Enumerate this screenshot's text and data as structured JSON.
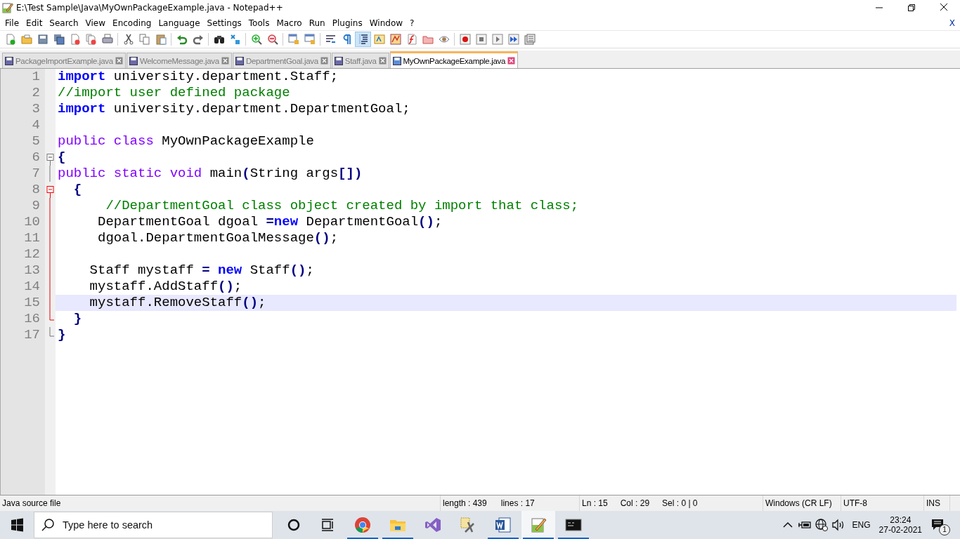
{
  "window": {
    "title": "E:\\Test Sample\\Java\\MyOwnPackageExample.java - Notepad++"
  },
  "menu": {
    "items": [
      "File",
      "Edit",
      "Search",
      "View",
      "Encoding",
      "Language",
      "Settings",
      "Tools",
      "Macro",
      "Run",
      "Plugins",
      "Window",
      "?"
    ],
    "close_label": "X"
  },
  "toolbar": [
    {
      "kind": "new",
      "pressed": false
    },
    {
      "kind": "open",
      "pressed": false
    },
    {
      "kind": "save",
      "pressed": false
    },
    {
      "kind": "save-all",
      "pressed": false
    },
    {
      "kind": "close",
      "pressed": false
    },
    {
      "kind": "close-all",
      "pressed": false
    },
    {
      "kind": "print",
      "pressed": false
    },
    {
      "kind": "separator"
    },
    {
      "kind": "cut",
      "pressed": false
    },
    {
      "kind": "copy",
      "pressed": false
    },
    {
      "kind": "paste",
      "pressed": false
    },
    {
      "kind": "separator"
    },
    {
      "kind": "undo",
      "pressed": false
    },
    {
      "kind": "redo",
      "pressed": false
    },
    {
      "kind": "separator"
    },
    {
      "kind": "find",
      "pressed": false
    },
    {
      "kind": "replace",
      "pressed": false
    },
    {
      "kind": "separator"
    },
    {
      "kind": "zoom-in",
      "pressed": false
    },
    {
      "kind": "zoom-out",
      "pressed": false
    },
    {
      "kind": "separator"
    },
    {
      "kind": "sync-v",
      "pressed": false
    },
    {
      "kind": "sync-h",
      "pressed": false
    },
    {
      "kind": "separator"
    },
    {
      "kind": "wrap",
      "pressed": false
    },
    {
      "kind": "pilcrow",
      "pressed": false
    },
    {
      "kind": "indent",
      "pressed": true
    },
    {
      "kind": "lang",
      "pressed": false
    },
    {
      "kind": "map",
      "pressed": false
    },
    {
      "kind": "func",
      "pressed": false
    },
    {
      "kind": "folder",
      "pressed": false
    },
    {
      "kind": "eye",
      "pressed": false
    },
    {
      "kind": "separator"
    },
    {
      "kind": "record",
      "pressed": false
    },
    {
      "kind": "stop",
      "pressed": false
    },
    {
      "kind": "play",
      "pressed": false
    },
    {
      "kind": "play-multi",
      "pressed": false
    },
    {
      "kind": "save-macro",
      "pressed": false
    }
  ],
  "tabs": [
    {
      "label": "PackageImportExample.java",
      "selected": false
    },
    {
      "label": "WelcomeMessage.java",
      "selected": false
    },
    {
      "label": "DepartmentGoal.java",
      "selected": false
    },
    {
      "label": "Staff.java",
      "selected": false
    },
    {
      "label": "MyOwnPackageExample.java",
      "selected": true
    }
  ],
  "editor": {
    "lines": [
      {
        "number": "1",
        "kind": "plain",
        "current": false,
        "tokens": [
          {
            "text": "import",
            "kind": "keyword"
          },
          {
            "text": " university.department.Staff;",
            "kind": "plain"
          }
        ]
      },
      {
        "number": "2",
        "kind": "plain",
        "current": false,
        "tokens": [
          {
            "text": "//import user defined package",
            "kind": "comment"
          }
        ]
      },
      {
        "number": "3",
        "kind": "plain",
        "current": false,
        "tokens": [
          {
            "text": "import",
            "kind": "keyword"
          },
          {
            "text": " university.department.DepartmentGoal;",
            "kind": "plain"
          }
        ]
      },
      {
        "number": "4",
        "kind": "plain",
        "current": false
      },
      {
        "number": "5",
        "kind": "plain",
        "current": false,
        "tokens": [
          {
            "text": "public class",
            "kind": "type"
          },
          {
            "text": " MyOwnPackageExample",
            "kind": "plain"
          }
        ]
      },
      {
        "number": "6",
        "kind": "fold-start",
        "current": false,
        "tokens": [
          {
            "text": "{",
            "kind": "operator"
          }
        ]
      },
      {
        "number": "7",
        "kind": "fold-body",
        "current": false,
        "tokens": [
          {
            "text": "public static void",
            "kind": "type"
          },
          {
            "text": " main",
            "kind": "plain"
          },
          {
            "text": "(",
            "kind": "operator"
          },
          {
            "text": "String args",
            "kind": "plain"
          },
          {
            "text": "[])",
            "kind": "operator"
          }
        ]
      },
      {
        "number": "8",
        "kind": "fold-start-active",
        "current": false,
        "tokens": [
          {
            "text": "  {",
            "kind": "operator"
          }
        ]
      },
      {
        "number": "9",
        "kind": "fold-body-active",
        "current": false,
        "tokens": [
          {
            "text": "      //DepartmentGoal class object created by import that class;",
            "kind": "comment"
          }
        ]
      },
      {
        "number": "10",
        "kind": "fold-body-active",
        "current": false,
        "tokens": [
          {
            "text": "     DepartmentGoal dgoal ",
            "kind": "plain"
          },
          {
            "text": "=",
            "kind": "operator"
          },
          {
            "text": "new",
            "kind": "keyword"
          },
          {
            "text": " DepartmentGoal",
            "kind": "plain"
          },
          {
            "text": "()",
            "kind": "operator"
          },
          {
            "text": ";",
            "kind": "plain"
          }
        ]
      },
      {
        "number": "11",
        "kind": "fold-body-active",
        "current": false,
        "tokens": [
          {
            "text": "     dgoal.DepartmentGoalMessage",
            "kind": "plain"
          },
          {
            "text": "()",
            "kind": "operator"
          },
          {
            "text": ";",
            "kind": "plain"
          }
        ]
      },
      {
        "number": "12",
        "kind": "fold-body-active",
        "current": false
      },
      {
        "number": "13",
        "kind": "fold-body-active",
        "current": false,
        "tokens": [
          {
            "text": "    Staff mystaff ",
            "kind": "plain"
          },
          {
            "text": "=",
            "kind": "operator"
          },
          {
            "text": " new",
            "kind": "keyword"
          },
          {
            "text": " Staff",
            "kind": "plain"
          },
          {
            "text": "()",
            "kind": "operator"
          },
          {
            "text": ";",
            "kind": "plain"
          }
        ]
      },
      {
        "number": "14",
        "kind": "fold-body-active",
        "current": false,
        "tokens": [
          {
            "text": "    mystaff.AddStaff",
            "kind": "plain"
          },
          {
            "text": "()",
            "kind": "operator"
          },
          {
            "text": ";",
            "kind": "plain"
          }
        ]
      },
      {
        "number": "15",
        "kind": "fold-body-active",
        "current": true,
        "tokens": [
          {
            "text": "    mystaff.RemoveStaff",
            "kind": "plain"
          },
          {
            "text": "()",
            "kind": "operator"
          },
          {
            "text": ";",
            "kind": "plain"
          }
        ]
      },
      {
        "number": "16",
        "kind": "fold-end-active",
        "current": false,
        "tokens": [
          {
            "text": "  }",
            "kind": "operator"
          }
        ]
      },
      {
        "number": "17",
        "kind": "fold-end",
        "current": false,
        "tokens": [
          {
            "text": "}",
            "kind": "operator"
          }
        ]
      }
    ]
  },
  "status_bar": [
    {
      "items": [
        "Java source file"
      ]
    },
    {
      "items": [
        "length : 439",
        "lines : 17"
      ]
    },
    {
      "items": [
        "Ln : 15",
        "Col : 29",
        "Sel : 0 | 0"
      ]
    },
    {
      "items": [
        "Windows (CR LF)"
      ]
    },
    {
      "items": [
        "UTF-8"
      ]
    },
    {
      "items": [
        "INS"
      ]
    }
  ],
  "taskbar": {
    "search": {
      "placeholder": "Type here to search"
    },
    "apps": [
      {
        "kind": "chrome",
        "running": true,
        "active": false
      },
      {
        "kind": "explorer",
        "running": true,
        "active": false
      },
      {
        "kind": "studio",
        "running": false,
        "active": false
      },
      {
        "kind": "tools",
        "running": false,
        "active": false
      },
      {
        "kind": "word",
        "running": true,
        "active": false
      },
      {
        "kind": "notepad",
        "running": true,
        "active": true
      },
      {
        "kind": "console",
        "running": true,
        "active": false
      }
    ],
    "language": "ENG",
    "time": "23:24",
    "date": "27-02-2021",
    "notifications": "1"
  }
}
